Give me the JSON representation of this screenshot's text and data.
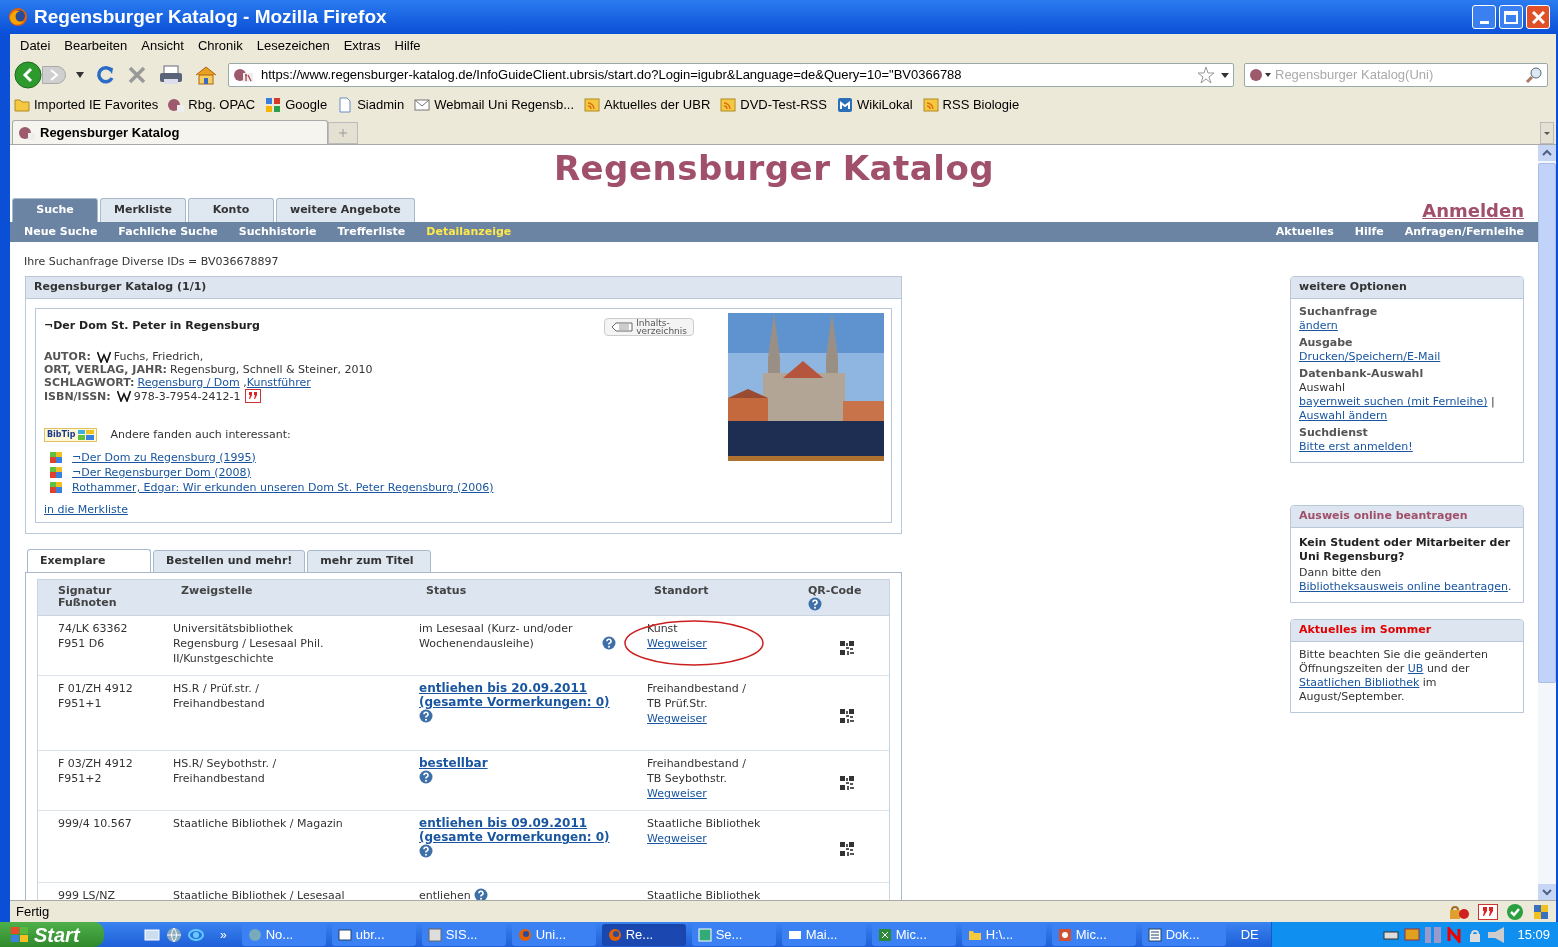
{
  "window": {
    "title": "Regensburger Katalog - Mozilla Firefox"
  },
  "menu": [
    "Datei",
    "Bearbeiten",
    "Ansicht",
    "Chronik",
    "Lesezeichen",
    "Extras",
    "Hilfe"
  ],
  "address_bar": {
    "url": "https://www.regensburger-katalog.de/InfoGuideClient.ubrsis/start.do?Login=igubr&Language=de&Query=10=\"BV0366788"
  },
  "search": {
    "placeholder": "Regensburger Katalog(Uni)"
  },
  "bookmarks": [
    {
      "label": "Imported IE Favorites",
      "kind": "folder"
    },
    {
      "label": "Rbg. OPAC",
      "kind": "site"
    },
    {
      "label": "Google",
      "kind": "google"
    },
    {
      "label": "Siadmin",
      "kind": "page"
    },
    {
      "label": "Webmail Uni Regensb...",
      "kind": "mail"
    },
    {
      "label": "Aktuelles der UBR",
      "kind": "feed"
    },
    {
      "label": "DVD-Test-RSS",
      "kind": "feed"
    },
    {
      "label": "WikiLokal",
      "kind": "wiki"
    },
    {
      "label": "RSS Biologie",
      "kind": "feed"
    }
  ],
  "browser_tabs": [
    {
      "label": "Regensburger Katalog",
      "selected": true
    }
  ],
  "page": {
    "heading": "Regensburger Katalog",
    "tabs": [
      {
        "label": "Suche",
        "selected": true
      },
      {
        "label": "Merkliste",
        "selected": false
      },
      {
        "label": "Konto",
        "selected": false
      },
      {
        "label": "weitere Angebote",
        "selected": false
      }
    ],
    "login_link": "Anmelden",
    "subnav": [
      {
        "label": "Neue Suche",
        "selected": false
      },
      {
        "label": "Fachliche Suche",
        "selected": false
      },
      {
        "label": "Suchhistorie",
        "selected": false
      },
      {
        "label": "Trefferliste",
        "selected": false
      },
      {
        "label": "Detailanzeige",
        "selected": true
      }
    ],
    "subnav_right": [
      "Aktuelles",
      "Hilfe",
      "Anfragen/Fernleihe"
    ],
    "query": "Ihre Suchanfrage Diverse IDs = BV036678897",
    "record": {
      "panel_title": "Regensburger Katalog (1/1)",
      "title": "¬Der Dom St. Peter in Regensburg",
      "toc_button": [
        "Inhalts-",
        "verzeichnis"
      ],
      "fields": [
        {
          "label": "AUTOR:",
          "wiki": true,
          "cite": false,
          "parts": [
            {
              "kind": "text",
              "text": "Fuchs, Friedrich,"
            }
          ]
        },
        {
          "label": "ORT, VERLAG, JAHR:",
          "wiki": false,
          "cite": false,
          "parts": [
            {
              "kind": "text",
              "text": "Regensburg, Schnell & Steiner, 2010"
            }
          ]
        },
        {
          "label": "SCHLAGWORT:",
          "wiki": false,
          "cite": false,
          "parts": [
            {
              "kind": "link",
              "text": "Regensburg / Dom"
            },
            {
              "kind": "text",
              "text": " ,"
            },
            {
              "kind": "link",
              "text": "Kunstführer"
            }
          ]
        },
        {
          "label": "ISBN/ISSN:",
          "wiki": true,
          "cite": true,
          "parts": [
            {
              "kind": "text",
              "text": "978-3-7954-2412-1"
            }
          ]
        }
      ],
      "bibtip": {
        "logo": "BibTip",
        "text": "Andere fanden auch interessant:",
        "items": [
          "¬Der Dom zu Regensburg (1995)",
          "¬Der Regensburger Dom (2008)",
          "Rothammer, Edgar: Wir erkunden unseren Dom St. Peter Regensburg (2006)"
        ]
      },
      "merkliste_link": "in die Merkliste"
    },
    "copies": {
      "tabs": [
        {
          "label": "Exemplare",
          "selected": true
        },
        {
          "label": "Bestellen und mehr!",
          "selected": false
        },
        {
          "label": "mehr zum Titel",
          "selected": false
        }
      ],
      "columns": [
        {
          "label": "Signatur Fußnoten",
          "help": false
        },
        {
          "label": "Zweigstelle",
          "help": false
        },
        {
          "label": "Status",
          "help": false
        },
        {
          "label": "Standort",
          "help": false
        },
        {
          "label": "QR-Code",
          "help": true
        }
      ],
      "rows": [
        {
          "signatur": [
            "74/LK 63362",
            "F951 D6"
          ],
          "branch": [
            "Universitätsbibliothek",
            "Regensburg / Lesesaal Phil.",
            "II/Kunstgeschichte"
          ],
          "status": {
            "kind": "text",
            "text": "im Lesesaal (Kurz- und/oder Wochenendausleihe)"
          },
          "location": [
            "Kunst"
          ],
          "guide_link": "Wegweiser",
          "qr": true,
          "circled": true
        },
        {
          "signatur": [
            "F 01/ZH 4912",
            "F951+1"
          ],
          "branch": [
            "HS.R / Prüf.str. /",
            "Freihandbestand"
          ],
          "status": {
            "kind": "link",
            "text": "entliehen bis 20.09.2011 (gesamte Vormerkungen: 0)"
          },
          "location": [
            "Freihandbestand /",
            "TB Prüf.Str."
          ],
          "guide_link": "Wegweiser",
          "qr": true,
          "circled": false
        },
        {
          "signatur": [
            "F 03/ZH 4912",
            "F951+2"
          ],
          "branch": [
            "HS.R/ Seybothstr. /",
            "Freihandbestand"
          ],
          "status": {
            "kind": "link",
            "text": "bestellbar"
          },
          "location": [
            "Freihandbestand /",
            "TB Seybothstr."
          ],
          "guide_link": "Wegweiser",
          "qr": true,
          "circled": false
        },
        {
          "signatur": [
            "999/4 10.567"
          ],
          "branch": [
            "Staatliche Bibliothek / Magazin"
          ],
          "status": {
            "kind": "link",
            "text": "entliehen bis 09.09.2011 (gesamte Vormerkungen: 0)"
          },
          "location": [
            "Staatliche Bibliothek"
          ],
          "guide_link": "Wegweiser",
          "qr": true,
          "circled": false
        },
        {
          "signatur": [
            "999 LS/NZ"
          ],
          "branch": [
            "Staatliche Bibliothek / Lesesaal"
          ],
          "status": {
            "kind": "text",
            "text": "entliehen"
          },
          "location": [
            "Staatliche Bibliothek"
          ],
          "qr": false,
          "circled": false
        }
      ]
    },
    "sidebar": [
      {
        "title": "weitere Optionen",
        "kind": "plain",
        "blocks": [
          {
            "kind": "heading",
            "text": "Suchanfrage"
          },
          {
            "kind": "para",
            "parts": [
              {
                "kind": "link",
                "text": "ändern"
              }
            ]
          },
          {
            "kind": "heading",
            "text": "Ausgabe"
          },
          {
            "kind": "para",
            "parts": [
              {
                "kind": "link",
                "text": "Drucken/Speichern/E-Mail"
              }
            ]
          },
          {
            "kind": "heading",
            "text": "Datenbank-Auswahl"
          },
          {
            "kind": "para",
            "parts": [
              {
                "kind": "text",
                "text": "Auswahl"
              }
            ]
          },
          {
            "kind": "para",
            "parts": [
              {
                "kind": "link",
                "text": "bayernweit suchen (mit Fernleihe)"
              },
              {
                "kind": "text",
                "text": " | "
              },
              {
                "kind": "link",
                "text": "Auswahl ändern"
              }
            ]
          },
          {
            "kind": "heading",
            "text": "Suchdienst"
          },
          {
            "kind": "para",
            "parts": [
              {
                "kind": "link",
                "text": "Bitte erst anmelden!"
              }
            ]
          }
        ]
      },
      {
        "title": "Ausweis online beantragen",
        "kind": "accent",
        "blocks": [
          {
            "kind": "strong",
            "text": "Kein Student oder Mitarbeiter der Uni Regensburg?"
          },
          {
            "kind": "para",
            "parts": [
              {
                "kind": "text",
                "text": "Dann bitte den "
              },
              {
                "kind": "link",
                "text": "Bibliotheksausweis online beantragen"
              },
              {
                "kind": "text",
                "text": "."
              }
            ]
          }
        ]
      },
      {
        "title": "Aktuelles im Sommer",
        "kind": "alert",
        "blocks": [
          {
            "kind": "para",
            "parts": [
              {
                "kind": "text",
                "text": "Bitte beachten Sie die geänderten Öffnungszeiten der "
              },
              {
                "kind": "link",
                "text": "UB"
              },
              {
                "kind": "text",
                "text": " und der "
              },
              {
                "kind": "link",
                "text": "Staatlichen Bibliothek"
              },
              {
                "kind": "text",
                "text": " im August/September."
              }
            ]
          }
        ]
      }
    ]
  },
  "status_bar": {
    "text": "Fertig"
  },
  "taskbar": {
    "start": "Start",
    "more": "»",
    "tasks": [
      {
        "label": "No...",
        "kind": "globe",
        "selected": false
      },
      {
        "label": "ubr...",
        "kind": "window",
        "selected": false
      },
      {
        "label": "SIS...",
        "kind": "app",
        "selected": false
      },
      {
        "label": "Uni...",
        "kind": "firefox",
        "selected": false
      },
      {
        "label": "Re...",
        "kind": "firefox",
        "selected": true
      },
      {
        "label": "Se...",
        "kind": "sheet",
        "selected": false
      },
      {
        "label": "Mai...",
        "kind": "mail",
        "selected": false
      },
      {
        "label": "Mic...",
        "kind": "excel",
        "selected": false
      },
      {
        "label": "H:\\...",
        "kind": "folder",
        "selected": false
      },
      {
        "label": "Mic...",
        "kind": "powerpoint",
        "selected": false
      },
      {
        "label": "Dok...",
        "kind": "word",
        "selected": false
      }
    ],
    "language": "DE",
    "clock": "15:09"
  }
}
